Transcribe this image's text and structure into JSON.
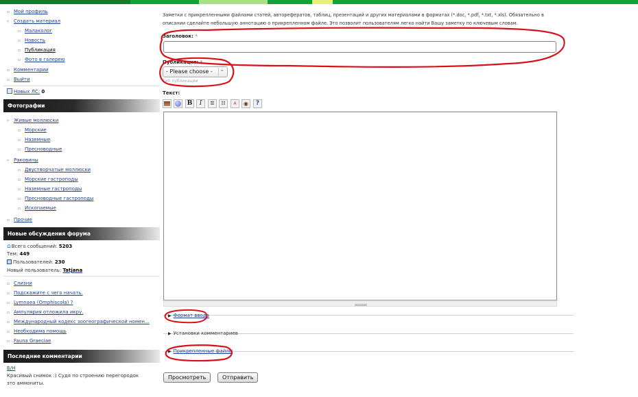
{
  "colors": {
    "topbar": "#0fa33a",
    "annotation": "#d81018",
    "link": "#1d3f8f"
  },
  "sidebar": {
    "user_menu": [
      {
        "label": "Мой профиль"
      },
      {
        "label": "Создать материал"
      },
      {
        "label": "Малаколог"
      },
      {
        "label": "Новость"
      },
      {
        "label": "Публикация"
      },
      {
        "label": "Фото в галерею"
      },
      {
        "label": "Комментарии"
      },
      {
        "label": "Выйти"
      }
    ],
    "new_pm_label": "Новых ЛС:",
    "new_pm_count": "0",
    "photos_header": "Фотографии",
    "photos": [
      {
        "label": "Живые моллюски"
      },
      {
        "label": "Морские"
      },
      {
        "label": "Наземные"
      },
      {
        "label": "Пресноводные"
      },
      {
        "label": "Раковины"
      },
      {
        "label": "Двустворчатые моллюски"
      },
      {
        "label": "Морские гастроподы"
      },
      {
        "label": "Наземные гастроподы"
      },
      {
        "label": "Пресноводные гастроподы"
      },
      {
        "label": "Ископаемые"
      },
      {
        "label": "Прочие"
      }
    ],
    "forum_header": "Новые обсуждения форума",
    "forum_stats": {
      "total_label": "Всего сообщений:",
      "total_value": "5203",
      "topics_label": "Тем:",
      "topics_value": "449",
      "users_label": "Пользователей:",
      "users_value": "230",
      "newuser_label": "Новый пользователь:",
      "newuser_value": "Tatjana"
    },
    "forum_topics": [
      {
        "label": "Слизни"
      },
      {
        "label": "Подскажите с чего начать."
      },
      {
        "label": "Lymnaea (Omphiscola) ?"
      },
      {
        "label": "Ампулярия отложила икру."
      },
      {
        "label": "Международный кодекс зоогеографической номен..."
      },
      {
        "label": "Необходима помощь"
      },
      {
        "label": "Fauna Graeciae"
      }
    ],
    "comments_header": "Последние комментарии",
    "comment_link": "Б/Н",
    "comment_text": "Красивый снимок :) Судя по строению перегородок это аммониты."
  },
  "main": {
    "description": "Заметки с прикрепленными файлами статей, авторефератов, таблиц, презентаций и других материалами в форматах (*.doc, *.pdf, *.txt, *.xls). Обязательно в описании сделайте небольшую аннотацию о прикрепленном файле. Это позволит пользователям легко найти Вашу заметку по ключевым словам.",
    "title_label": "Заголовок:",
    "required_mark": "*",
    "title_value": "",
    "pub_label": "Публикация:",
    "pub_selected": "- Please choose -",
    "pub_hint": "Тип публикации",
    "text_label": "Текст:",
    "toolbar": {
      "image": "insert-image-icon",
      "globe": "link-icon",
      "bold": "B",
      "italic": "I",
      "ol": "ordered-list-icon",
      "ul": "unordered-list-icon",
      "clean": "format-icon",
      "preview": "preview-icon",
      "help": "?"
    },
    "sections": {
      "input_format": "Формат ввода",
      "comment_settings": "Установки комментариев",
      "attached_files": "Прикрепленные файлы"
    },
    "buttons": {
      "preview": "Просмотреть",
      "submit": "Отправить"
    }
  }
}
